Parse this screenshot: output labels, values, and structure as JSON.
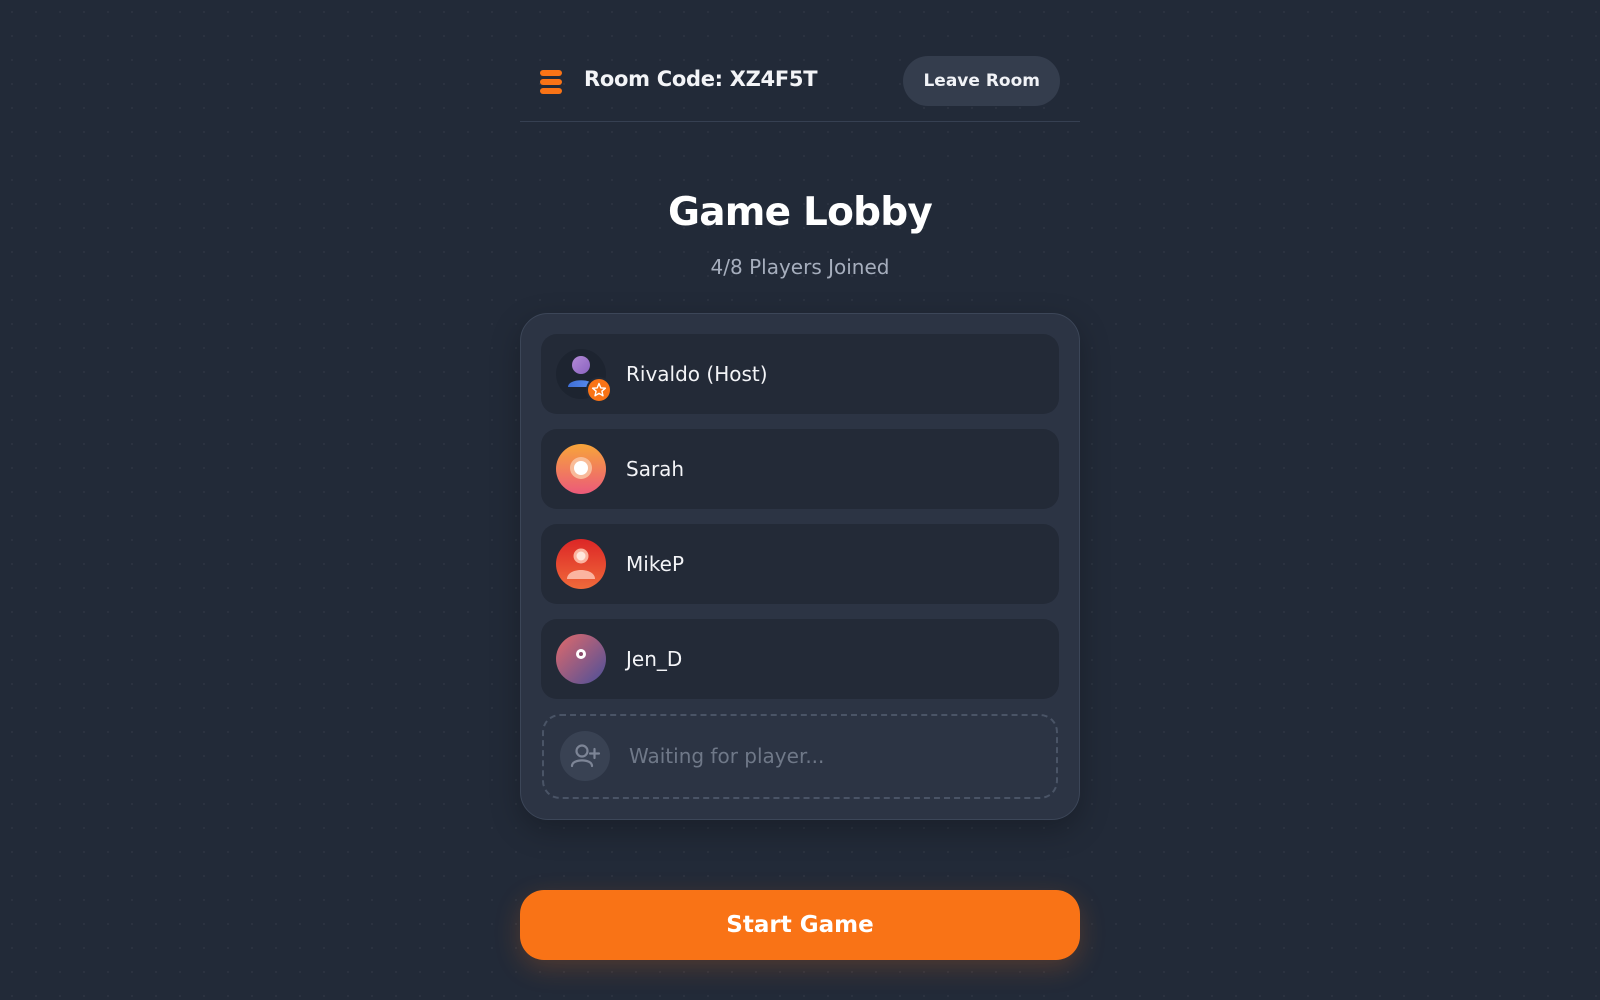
{
  "header": {
    "logo_icon": "stack-icon",
    "room_code": "Room Code: XZ4F5T",
    "leave_label": "Leave Room"
  },
  "lobby": {
    "title": "Game Lobby",
    "players_joined": "4/8 Players Joined"
  },
  "players": [
    {
      "name": "Rivaldo (Host)",
      "avatar": "host-avatar-icon",
      "badge": "star-icon"
    },
    {
      "name": "Sarah",
      "avatar": "orange-ring-avatar-icon"
    },
    {
      "name": "MikeP",
      "avatar": "red-person-avatar-icon"
    },
    {
      "name": "Jen_D",
      "avatar": "purple-dot-avatar-icon"
    }
  ],
  "waiting_slot": {
    "text": "Waiting for player...",
    "icon": "add-user-icon"
  },
  "actions": {
    "start_label": "Start Game"
  },
  "colors": {
    "accent": "#f97316",
    "background": "#222a38",
    "panel": "#2c3444",
    "row": "#232a37"
  }
}
